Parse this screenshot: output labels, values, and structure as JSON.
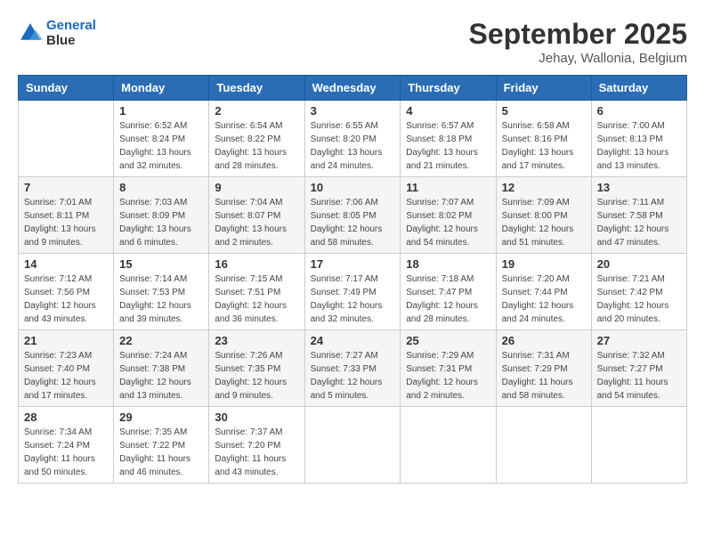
{
  "logo": {
    "line1": "General",
    "line2": "Blue"
  },
  "header": {
    "month": "September 2025",
    "location": "Jehay, Wallonia, Belgium"
  },
  "weekdays": [
    "Sunday",
    "Monday",
    "Tuesday",
    "Wednesday",
    "Thursday",
    "Friday",
    "Saturday"
  ],
  "weeks": [
    [
      {
        "day": "",
        "info": ""
      },
      {
        "day": "1",
        "info": "Sunrise: 6:52 AM\nSunset: 8:24 PM\nDaylight: 13 hours\nand 32 minutes."
      },
      {
        "day": "2",
        "info": "Sunrise: 6:54 AM\nSunset: 8:22 PM\nDaylight: 13 hours\nand 28 minutes."
      },
      {
        "day": "3",
        "info": "Sunrise: 6:55 AM\nSunset: 8:20 PM\nDaylight: 13 hours\nand 24 minutes."
      },
      {
        "day": "4",
        "info": "Sunrise: 6:57 AM\nSunset: 8:18 PM\nDaylight: 13 hours\nand 21 minutes."
      },
      {
        "day": "5",
        "info": "Sunrise: 6:58 AM\nSunset: 8:16 PM\nDaylight: 13 hours\nand 17 minutes."
      },
      {
        "day": "6",
        "info": "Sunrise: 7:00 AM\nSunset: 8:13 PM\nDaylight: 13 hours\nand 13 minutes."
      }
    ],
    [
      {
        "day": "7",
        "info": "Sunrise: 7:01 AM\nSunset: 8:11 PM\nDaylight: 13 hours\nand 9 minutes."
      },
      {
        "day": "8",
        "info": "Sunrise: 7:03 AM\nSunset: 8:09 PM\nDaylight: 13 hours\nand 6 minutes."
      },
      {
        "day": "9",
        "info": "Sunrise: 7:04 AM\nSunset: 8:07 PM\nDaylight: 13 hours\nand 2 minutes."
      },
      {
        "day": "10",
        "info": "Sunrise: 7:06 AM\nSunset: 8:05 PM\nDaylight: 12 hours\nand 58 minutes."
      },
      {
        "day": "11",
        "info": "Sunrise: 7:07 AM\nSunset: 8:02 PM\nDaylight: 12 hours\nand 54 minutes."
      },
      {
        "day": "12",
        "info": "Sunrise: 7:09 AM\nSunset: 8:00 PM\nDaylight: 12 hours\nand 51 minutes."
      },
      {
        "day": "13",
        "info": "Sunrise: 7:11 AM\nSunset: 7:58 PM\nDaylight: 12 hours\nand 47 minutes."
      }
    ],
    [
      {
        "day": "14",
        "info": "Sunrise: 7:12 AM\nSunset: 7:56 PM\nDaylight: 12 hours\nand 43 minutes."
      },
      {
        "day": "15",
        "info": "Sunrise: 7:14 AM\nSunset: 7:53 PM\nDaylight: 12 hours\nand 39 minutes."
      },
      {
        "day": "16",
        "info": "Sunrise: 7:15 AM\nSunset: 7:51 PM\nDaylight: 12 hours\nand 36 minutes."
      },
      {
        "day": "17",
        "info": "Sunrise: 7:17 AM\nSunset: 7:49 PM\nDaylight: 12 hours\nand 32 minutes."
      },
      {
        "day": "18",
        "info": "Sunrise: 7:18 AM\nSunset: 7:47 PM\nDaylight: 12 hours\nand 28 minutes."
      },
      {
        "day": "19",
        "info": "Sunrise: 7:20 AM\nSunset: 7:44 PM\nDaylight: 12 hours\nand 24 minutes."
      },
      {
        "day": "20",
        "info": "Sunrise: 7:21 AM\nSunset: 7:42 PM\nDaylight: 12 hours\nand 20 minutes."
      }
    ],
    [
      {
        "day": "21",
        "info": "Sunrise: 7:23 AM\nSunset: 7:40 PM\nDaylight: 12 hours\nand 17 minutes."
      },
      {
        "day": "22",
        "info": "Sunrise: 7:24 AM\nSunset: 7:38 PM\nDaylight: 12 hours\nand 13 minutes."
      },
      {
        "day": "23",
        "info": "Sunrise: 7:26 AM\nSunset: 7:35 PM\nDaylight: 12 hours\nand 9 minutes."
      },
      {
        "day": "24",
        "info": "Sunrise: 7:27 AM\nSunset: 7:33 PM\nDaylight: 12 hours\nand 5 minutes."
      },
      {
        "day": "25",
        "info": "Sunrise: 7:29 AM\nSunset: 7:31 PM\nDaylight: 12 hours\nand 2 minutes."
      },
      {
        "day": "26",
        "info": "Sunrise: 7:31 AM\nSunset: 7:29 PM\nDaylight: 11 hours\nand 58 minutes."
      },
      {
        "day": "27",
        "info": "Sunrise: 7:32 AM\nSunset: 7:27 PM\nDaylight: 11 hours\nand 54 minutes."
      }
    ],
    [
      {
        "day": "28",
        "info": "Sunrise: 7:34 AM\nSunset: 7:24 PM\nDaylight: 11 hours\nand 50 minutes."
      },
      {
        "day": "29",
        "info": "Sunrise: 7:35 AM\nSunset: 7:22 PM\nDaylight: 11 hours\nand 46 minutes."
      },
      {
        "day": "30",
        "info": "Sunrise: 7:37 AM\nSunset: 7:20 PM\nDaylight: 11 hours\nand 43 minutes."
      },
      {
        "day": "",
        "info": ""
      },
      {
        "day": "",
        "info": ""
      },
      {
        "day": "",
        "info": ""
      },
      {
        "day": "",
        "info": ""
      }
    ]
  ]
}
